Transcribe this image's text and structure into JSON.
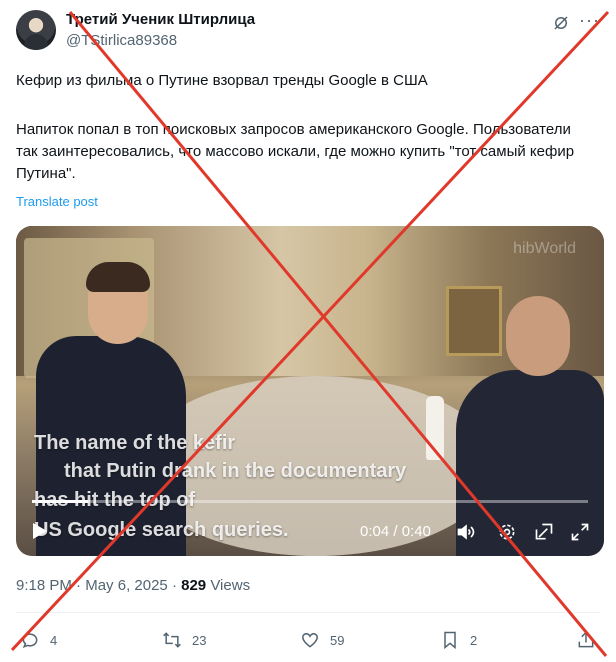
{
  "author": {
    "name": "Третий Ученик Штирлица",
    "handle": "@TStirlica89368"
  },
  "post": {
    "paragraph1": "Кефир из фильма о Путине взорвал тренды Google в США",
    "paragraph2": "Напиток попал в топ поисковых запросов американского Google. Пользователи так заинтересовались, что массово искали, где можно купить \"тот самый кефир Путина\".",
    "translate_label": "Translate post"
  },
  "video": {
    "watermark": "hibWorld",
    "subtitle_lines": [
      "The name of the kefir",
      "that Putin drank in the documentary",
      "has hit the top of",
      "US Google search queries."
    ],
    "time": "0:04 / 0:40",
    "progress": 0.1
  },
  "meta": {
    "time": "9:18 PM",
    "separator1": "·",
    "date": "May 6, 2025",
    "separator2": "·",
    "views_count": "829",
    "views_label": "Views"
  },
  "actions": {
    "replies": "4",
    "reposts": "23",
    "likes": "59",
    "bookmarks": "2"
  },
  "colors": {
    "accent": "#1d9bf0",
    "cross": "#e0392b"
  },
  "icons": [
    "grok-icon",
    "more-icon",
    "play-icon",
    "volume-icon",
    "settings-icon",
    "pip-icon",
    "fullscreen-icon",
    "reply-icon",
    "repost-icon",
    "like-icon",
    "bookmark-icon",
    "share-icon"
  ]
}
